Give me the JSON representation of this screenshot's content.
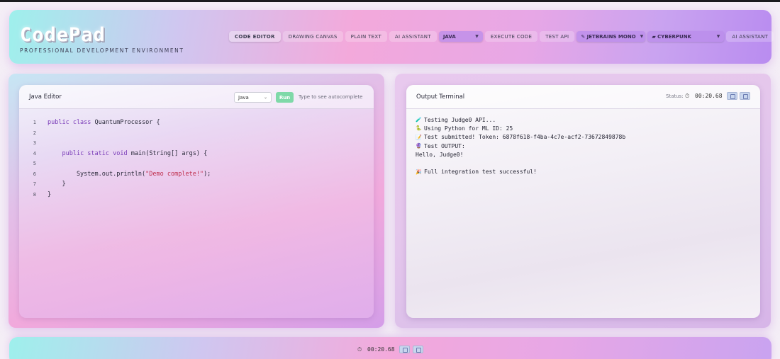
{
  "header": {
    "logo": "CodePad",
    "subtitle": "PROFESSIONAL DEVELOPMENT ENVIRONMENT",
    "nav": [
      {
        "label": "CODE EDITOR"
      },
      {
        "label": "DRAWING CANVAS"
      },
      {
        "label": "PLAIN TEXT"
      },
      {
        "label": "AI ASSISTANT"
      },
      {
        "label": "JAVA"
      },
      {
        "label": "EXECUTE CODE"
      },
      {
        "label": "TEST API"
      },
      {
        "label": "JETBRAINS MONO"
      },
      {
        "label": "CYBERPUNK"
      },
      {
        "label": "AI ASSISTANT"
      }
    ]
  },
  "editor": {
    "title": "Java Editor",
    "language_value": "Java",
    "run_label": "Run",
    "hint": "Type to see autocomplete",
    "lines": [
      {
        "num": "1",
        "text": "public class QuantumProcessor {"
      },
      {
        "num": "2",
        "text": ""
      },
      {
        "num": "3",
        "text": ""
      },
      {
        "num": "4",
        "text": "    public static void main(String[] args) {"
      },
      {
        "num": "5",
        "text": ""
      },
      {
        "num": "6",
        "text": "        System.out.println(\"Demo complete!\");"
      },
      {
        "num": "7",
        "text": "    }"
      },
      {
        "num": "8",
        "text": "}"
      }
    ]
  },
  "terminal": {
    "title": "Output Terminal",
    "status_label": "Status:",
    "timer_icon": "⏱",
    "time": "00:20.68",
    "output": [
      {
        "icon": "🧪",
        "text": "Testing Judge0 API..."
      },
      {
        "icon": "🐍",
        "text": "Using Python for ML ID: 25"
      },
      {
        "icon": "📝",
        "text": "Test submitted! Token: 6878f618-f4ba-4c7e-acf2-73672849878b"
      },
      {
        "icon": "🔮",
        "text": "Test OUTPUT:"
      },
      {
        "icon": "",
        "text": "Hello, Judge0!"
      },
      {
        "icon": "",
        "text": ""
      },
      {
        "icon": "🎉",
        "text": "Full integration test successful!"
      }
    ]
  },
  "footer": {
    "timer_icon": "⏱",
    "time": "00:20.68"
  }
}
